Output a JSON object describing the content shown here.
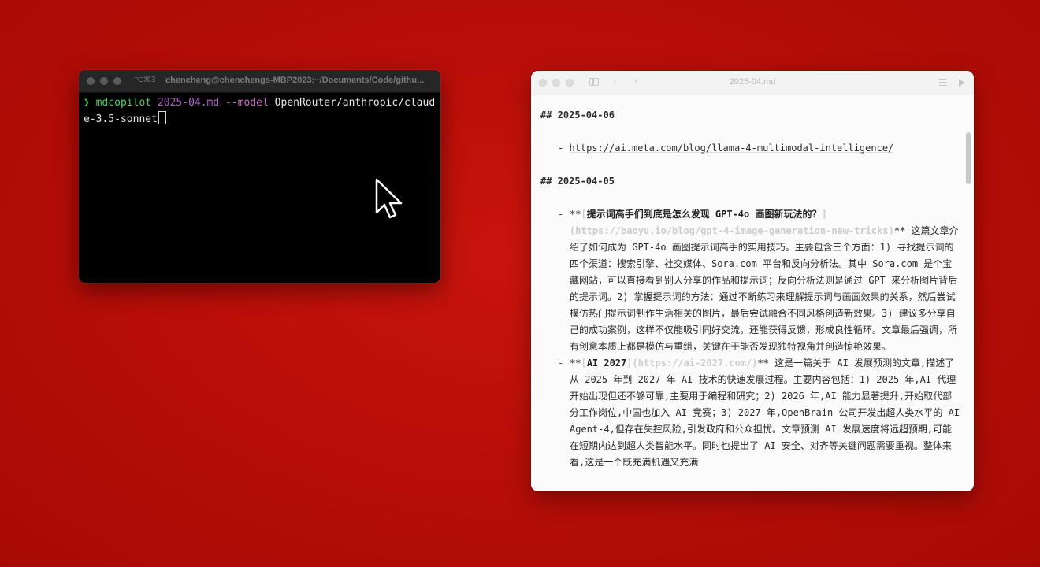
{
  "terminal": {
    "keyboard_hint": "⌥⌘3",
    "title": "chencheng@chenchengs-MBP2023:~/Documents/Code/githu...",
    "prompt_symbol": "❯",
    "command": "mdcopilot",
    "file_arg": "2025-04.md",
    "flag": "--model",
    "value": "OpenRouter/anthropic/claude-3.5-sonnet"
  },
  "editor": {
    "title": "2025-04.md",
    "nav_back": "‹",
    "nav_forward": "›",
    "sections": [
      {
        "heading": "## 2025-04-06"
      },
      {
        "heading": "## 2025-04-05"
      }
    ],
    "link_line": {
      "dash": "-",
      "url": "https://ai.meta.com/blog/llama-4-multimodal-intelligence/"
    },
    "items": [
      {
        "dash": "-",
        "bold_open": "**",
        "bracket_open": "[",
        "title": "提示词高手们到底是怎么发现 GPT-4o 画图新玩法的？",
        "link": "](https://baoyu.io/blog/gpt-4-image-generation-new-tricks)",
        "bold_close": "**",
        "description": " 这篇文章介绍了如何成为 GPT-4o 画图提示词高手的实用技巧。主要包含三个方面：1) 寻找提示词的四个渠道：搜索引擎、社交媒体、Sora.com 平台和反向分析法。其中 Sora.com 是个宝藏网站，可以直接看到别人分享的作品和提示词；反向分析法则是通过 GPT 来分析图片背后的提示词。2) 掌握提示词的方法：通过不断练习来理解提示词与画面效果的关系，然后尝试模仿热门提示词制作生活相关的图片，最后尝试融合不同风格创造新效果。3) 建议多分享自己的成功案例，这样不仅能吸引同好交流，还能获得反馈，形成良性循环。文章最后强调，所有创意本质上都是模仿与重组，关键在于能否发现独特视角并创造惊艳效果。"
      },
      {
        "dash": "-",
        "bold_open": "**",
        "bracket_open": "[",
        "title": "AI 2027",
        "link": "](https://ai-2027.com/)",
        "bold_close": "**",
        "description": " 这是一篇关于 AI 发展预测的文章,描述了从 2025 年到 2027 年 AI 技术的快速发展过程。主要内容包括：1) 2025 年,AI 代理开始出现但还不够可靠,主要用于编程和研究；2) 2026 年,AI 能力显著提升,开始取代部分工作岗位,中国也加入 AI 竞赛；3) 2027 年,OpenBrain 公司开发出超人类水平的 AI Agent-4,但存在失控风险,引发政府和公众担忧。文章预测 AI 发展速度将远超预期,可能在短期内达到超人类智能水平。同时也提出了 AI 安全、对齐等关键问题需要重视。整体来看,这是一个既充满机遇又充满"
      }
    ]
  },
  "colors": {
    "background": "#b60d07",
    "terminal_bg": "#000000",
    "prompt_green": "#2fd14a",
    "file_purple": "#b164c8",
    "editor_bg": "#fbfbfb"
  }
}
